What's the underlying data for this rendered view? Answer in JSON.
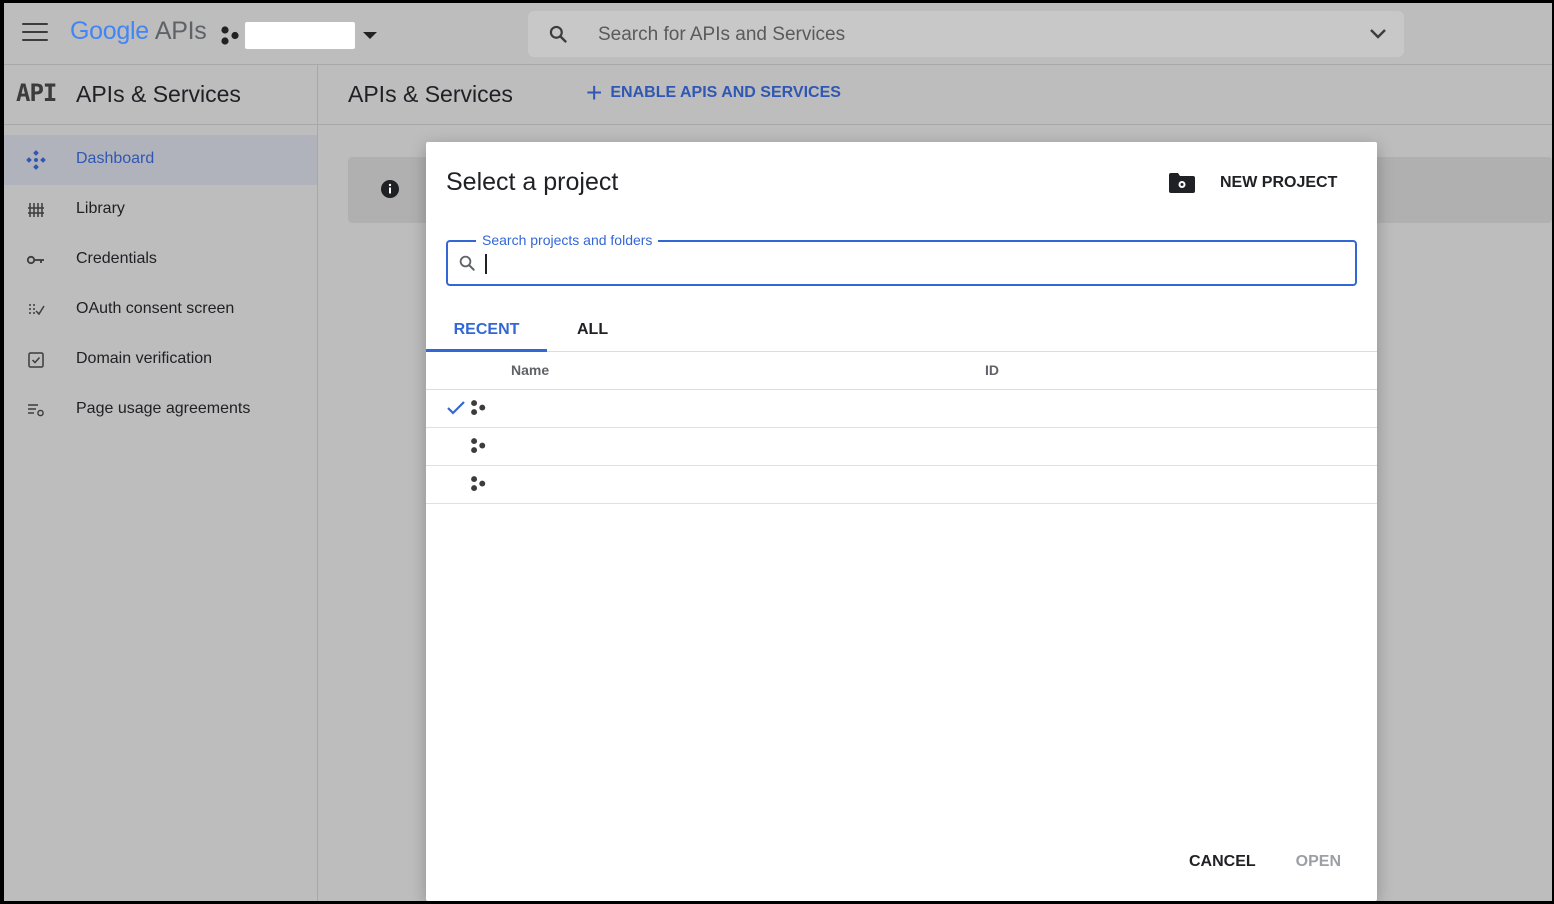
{
  "topbar": {
    "logo_google": "Google",
    "logo_apis": "APIs",
    "search_placeholder": "Search for APIs and Services"
  },
  "sidebar": {
    "api_mark": "API",
    "title": "APIs & Services",
    "items": [
      {
        "label": "Dashboard",
        "icon": "dashboard-icon",
        "active": true
      },
      {
        "label": "Library",
        "icon": "library-icon"
      },
      {
        "label": "Credentials",
        "icon": "key-icon"
      },
      {
        "label": "OAuth consent screen",
        "icon": "consent-icon"
      },
      {
        "label": "Domain verification",
        "icon": "checkbox-icon"
      },
      {
        "label": "Page usage agreements",
        "icon": "settings-list-icon"
      }
    ]
  },
  "main": {
    "title": "APIs & Services",
    "enable_button": "ENABLE APIS AND SERVICES"
  },
  "modal": {
    "title": "Select a project",
    "new_project": "NEW PROJECT",
    "search_label": "Search projects and folders",
    "search_value": "",
    "tabs": [
      "RECENT",
      "ALL"
    ],
    "columns": [
      "Name",
      "ID"
    ],
    "rows": [
      {
        "name": "",
        "id": "",
        "selected": true
      },
      {
        "name": "",
        "id": "",
        "selected": false
      },
      {
        "name": "",
        "id": "",
        "selected": false
      }
    ],
    "cancel": "CANCEL",
    "open": "OPEN"
  },
  "colors": {
    "accent": "#3367d6",
    "overlay": "#bdbdbd"
  }
}
